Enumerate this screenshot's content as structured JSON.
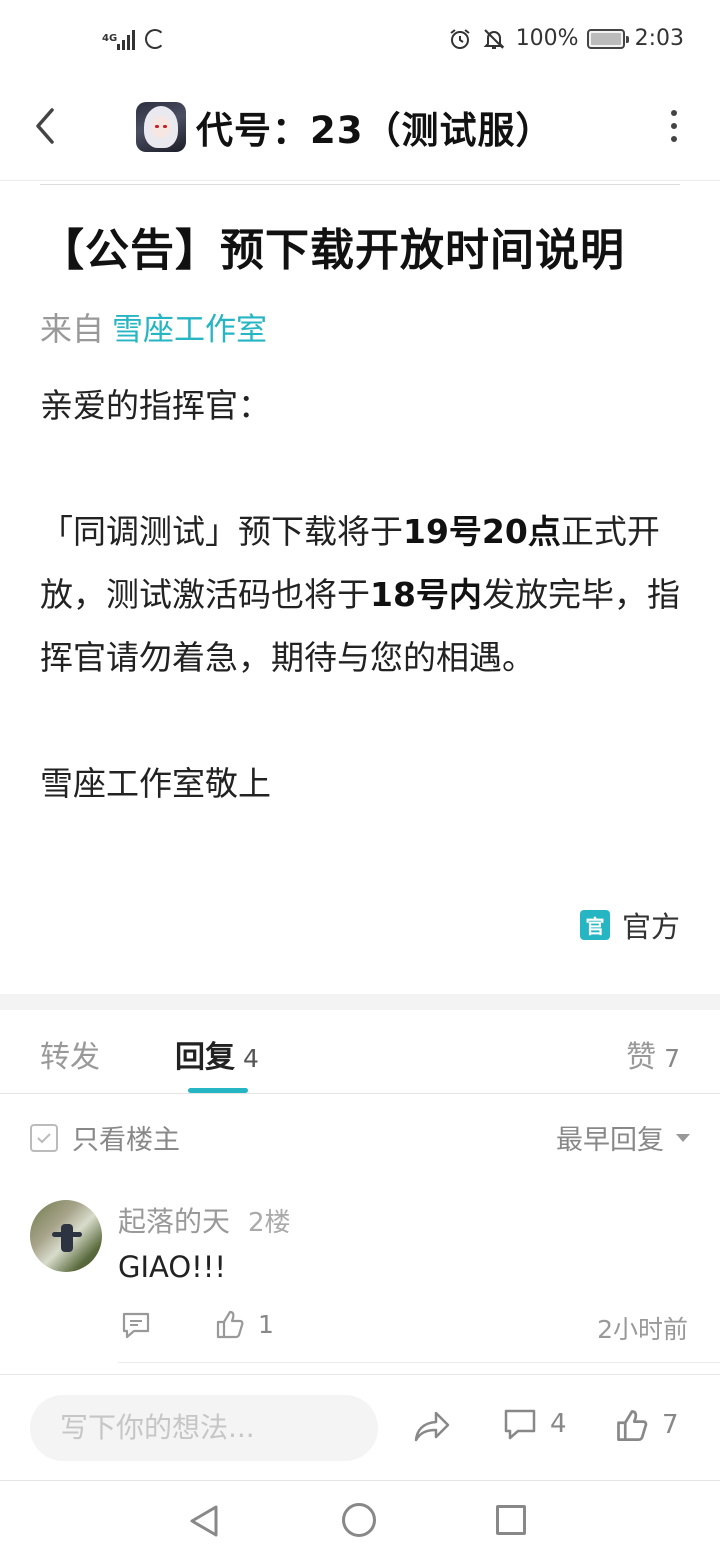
{
  "status_bar": {
    "network": "4G",
    "battery": "100%",
    "time": "2:03"
  },
  "header": {
    "title": "代号：23（测试服）",
    "app_icon": "game-avatar-icon"
  },
  "post": {
    "title": "【公告】预下载开放时间说明",
    "from_label": "来自",
    "author": "雪座工作室",
    "greeting": "亲爱的指挥官：",
    "para_1": "「同调测试」预下载将于",
    "para_2_bold": "19号20点",
    "para_3": "正式开放，测试激活码也将于",
    "para_4_bold": "18号内",
    "para_5": "发放完毕，指挥官请勿着急，期待与您的相遇。",
    "signature": "雪座工作室敬上",
    "official_badge": "官",
    "official_label": "官方"
  },
  "tabs": {
    "forward": "转发",
    "reply": "回复",
    "reply_count": "4",
    "like": "赞",
    "like_count": "7"
  },
  "filter": {
    "only_host": "只看楼主",
    "sort": "最早回复"
  },
  "comments": [
    {
      "user": "起落的天",
      "floor": "2楼",
      "text": "GIAO!!!",
      "likes": "1",
      "time": "2小时前"
    }
  ],
  "bottom_bar": {
    "placeholder": "写下你的想法...",
    "comment_count": "4",
    "like_count": "7"
  },
  "colors": {
    "accent": "#26b5c3",
    "text": "#222222",
    "muted": "#999999"
  }
}
